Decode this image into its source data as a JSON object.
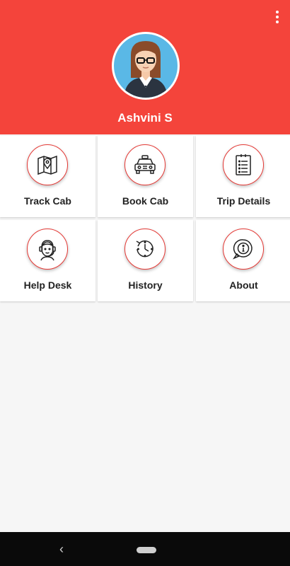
{
  "header": {
    "user_name": "Ashvini S",
    "bg_color": "#f4443b",
    "menu_icon": "more-vert-icon"
  },
  "tiles": [
    {
      "label": "Track Cab",
      "icon": "map-pin-icon"
    },
    {
      "label": "Book Cab",
      "icon": "taxi-icon"
    },
    {
      "label": "Trip Details",
      "icon": "document-list-icon"
    },
    {
      "label": "Help Desk",
      "icon": "support-agent-icon"
    },
    {
      "label": "History",
      "icon": "history-clock-icon"
    },
    {
      "label": "About",
      "icon": "info-bubble-icon"
    }
  ],
  "navbar": {
    "back_glyph": "‹"
  },
  "colors": {
    "accent": "#e53935",
    "background": "#f6f6f6"
  }
}
